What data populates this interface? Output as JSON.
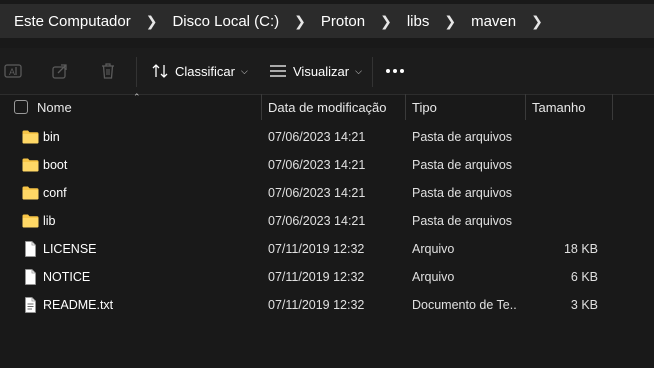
{
  "breadcrumb": [
    "Este Computador",
    "Disco Local (C:)",
    "Proton",
    "libs",
    "maven"
  ],
  "toolbar": {
    "sort_label": "Classificar",
    "view_label": "Visualizar",
    "icons": [
      "rename-icon",
      "share-icon",
      "delete-icon",
      "sort-icon",
      "view-icon",
      "more-icon"
    ]
  },
  "columns": {
    "name": "Nome",
    "date": "Data de modificação",
    "type": "Tipo",
    "size": "Tamanho"
  },
  "files": [
    {
      "name": "bin",
      "date": "07/06/2023 14:21",
      "type": "Pasta de arquivos",
      "size": "",
      "icon": "folder-icon"
    },
    {
      "name": "boot",
      "date": "07/06/2023 14:21",
      "type": "Pasta de arquivos",
      "size": "",
      "icon": "folder-icon"
    },
    {
      "name": "conf",
      "date": "07/06/2023 14:21",
      "type": "Pasta de arquivos",
      "size": "",
      "icon": "folder-icon"
    },
    {
      "name": "lib",
      "date": "07/06/2023 14:21",
      "type": "Pasta de arquivos",
      "size": "",
      "icon": "folder-icon"
    },
    {
      "name": "LICENSE",
      "date": "07/11/2019 12:32",
      "type": "Arquivo",
      "size": "18 KB",
      "icon": "file-icon"
    },
    {
      "name": "NOTICE",
      "date": "07/11/2019 12:32",
      "type": "Arquivo",
      "size": "6 KB",
      "icon": "file-icon"
    },
    {
      "name": "README.txt",
      "date": "07/11/2019 12:32",
      "type": "Documento de Te...",
      "size": "3 KB",
      "icon": "text-file-icon"
    }
  ],
  "colors": {
    "background": "#191919",
    "address_bar": "#2b2b2b",
    "folder": "#f7c547"
  }
}
